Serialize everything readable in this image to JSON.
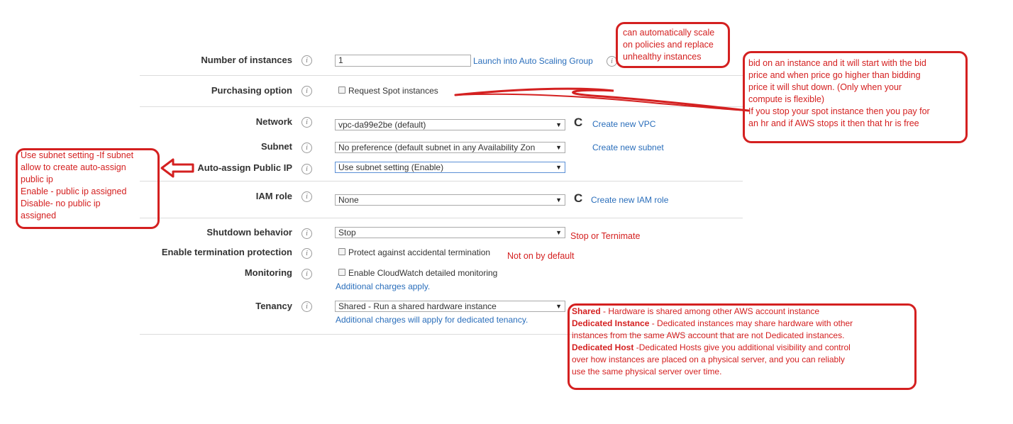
{
  "form": {
    "number_of_instances": {
      "label": "Number of instances",
      "value": "1",
      "link": "Launch into Auto Scaling Group"
    },
    "purchasing_option": {
      "label": "Purchasing option",
      "checkbox": "Request Spot instances"
    },
    "network": {
      "label": "Network",
      "value": "vpc-da99e2be (default)",
      "link": "Create new VPC"
    },
    "subnet": {
      "label": "Subnet",
      "value": "No preference (default subnet in any Availability Zon",
      "link": "Create new subnet"
    },
    "auto_assign_ip": {
      "label": "Auto-assign Public IP",
      "value": "Use subnet setting (Enable)"
    },
    "iam_role": {
      "label": "IAM role",
      "value": "None",
      "link": "Create new IAM role"
    },
    "shutdown_behavior": {
      "label": "Shutdown behavior",
      "value": "Stop"
    },
    "termination_protection": {
      "label": "Enable termination protection",
      "checkbox": "Protect against accidental termination"
    },
    "monitoring": {
      "label": "Monitoring",
      "checkbox": "Enable CloudWatch detailed monitoring",
      "note": "Additional charges apply."
    },
    "tenancy": {
      "label": "Tenancy",
      "value": "Shared - Run a shared hardware instance",
      "note": "Additional charges will apply for dedicated tenancy."
    }
  },
  "annotations": {
    "autoscaling": [
      "can automatically scale",
      "on policies and replace",
      "unhealthy instances"
    ],
    "spot": [
      "bid on an instance and it will start with the bid",
      "price and when price go higher than bidding",
      "price it will shut down. (Only when your",
      "compute is flexible)",
      "If you stop your spot instance then you pay for",
      "an hr and if AWS stops it then that hr is free"
    ],
    "subnet_setting": [
      "Use subnet setting -If subnet",
      "allow to create auto-assign",
      "public ip",
      "Enable - public ip assigned",
      "Disable- no public ip",
      "assigned"
    ],
    "shutdown": "Stop or Ternimate",
    "termination": "Not on by default",
    "tenancy": {
      "shared_head": "Shared",
      "shared_text": " -  Hardware is shared among other AWS account instance",
      "dedicated_instance_head": "Dedicated Instance",
      "dedicated_instance_text1": " -  Dedicated instances may share hardware with other",
      "dedicated_instance_text2": "instances from the same AWS account that are not Dedicated instances.",
      "dedicated_host_head": "Dedicated Host",
      "dedicated_host_text1": " -Dedicated Hosts give you additional visibility and control",
      "dedicated_host_text2": "over how instances are placed on a physical server, and you can reliably",
      "dedicated_host_text3": "use the same physical server over time."
    }
  },
  "colors": {
    "annotation": "#d42020",
    "link": "#2a6ebb"
  },
  "icons": {
    "info": "info-icon",
    "refresh": "refresh-icon",
    "arrow": "left-arrow-icon",
    "dropdown": "chevron-down-icon"
  },
  "glyphs": {
    "info": "i",
    "refresh": "C",
    "dropdown": "▼"
  }
}
